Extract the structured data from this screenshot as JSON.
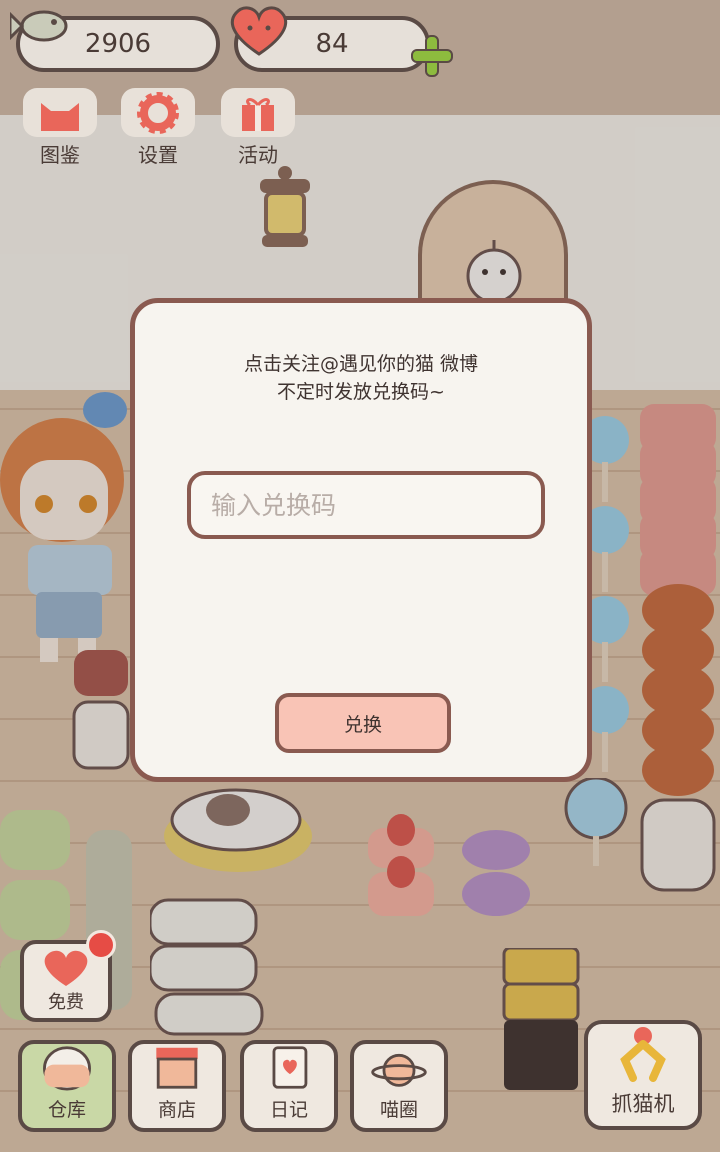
{
  "currency": {
    "fish": "2906",
    "hearts": "84"
  },
  "top_menu": {
    "atlas": "图鉴",
    "settings": "设置",
    "activity": "活动"
  },
  "dialog": {
    "message_line1": "点击关注@遇见你的猫 微博",
    "message_line2": "不定时发放兑换码~",
    "input_placeholder": "输入兑换码",
    "input_value": "",
    "redeem_label": "兑换"
  },
  "bottom_bar": {
    "free": "免费",
    "warehouse": "仓库",
    "shop": "商店",
    "diary": "日记",
    "cat_circle": "喵圈",
    "claw_machine": "抓猫机"
  },
  "colors": {
    "accent_pink": "#f9c4b6",
    "border_brown": "#8a5a50",
    "heart_red": "#e9665a",
    "plus_green": "#8dbb3e",
    "badge_red": "#e64c45"
  }
}
